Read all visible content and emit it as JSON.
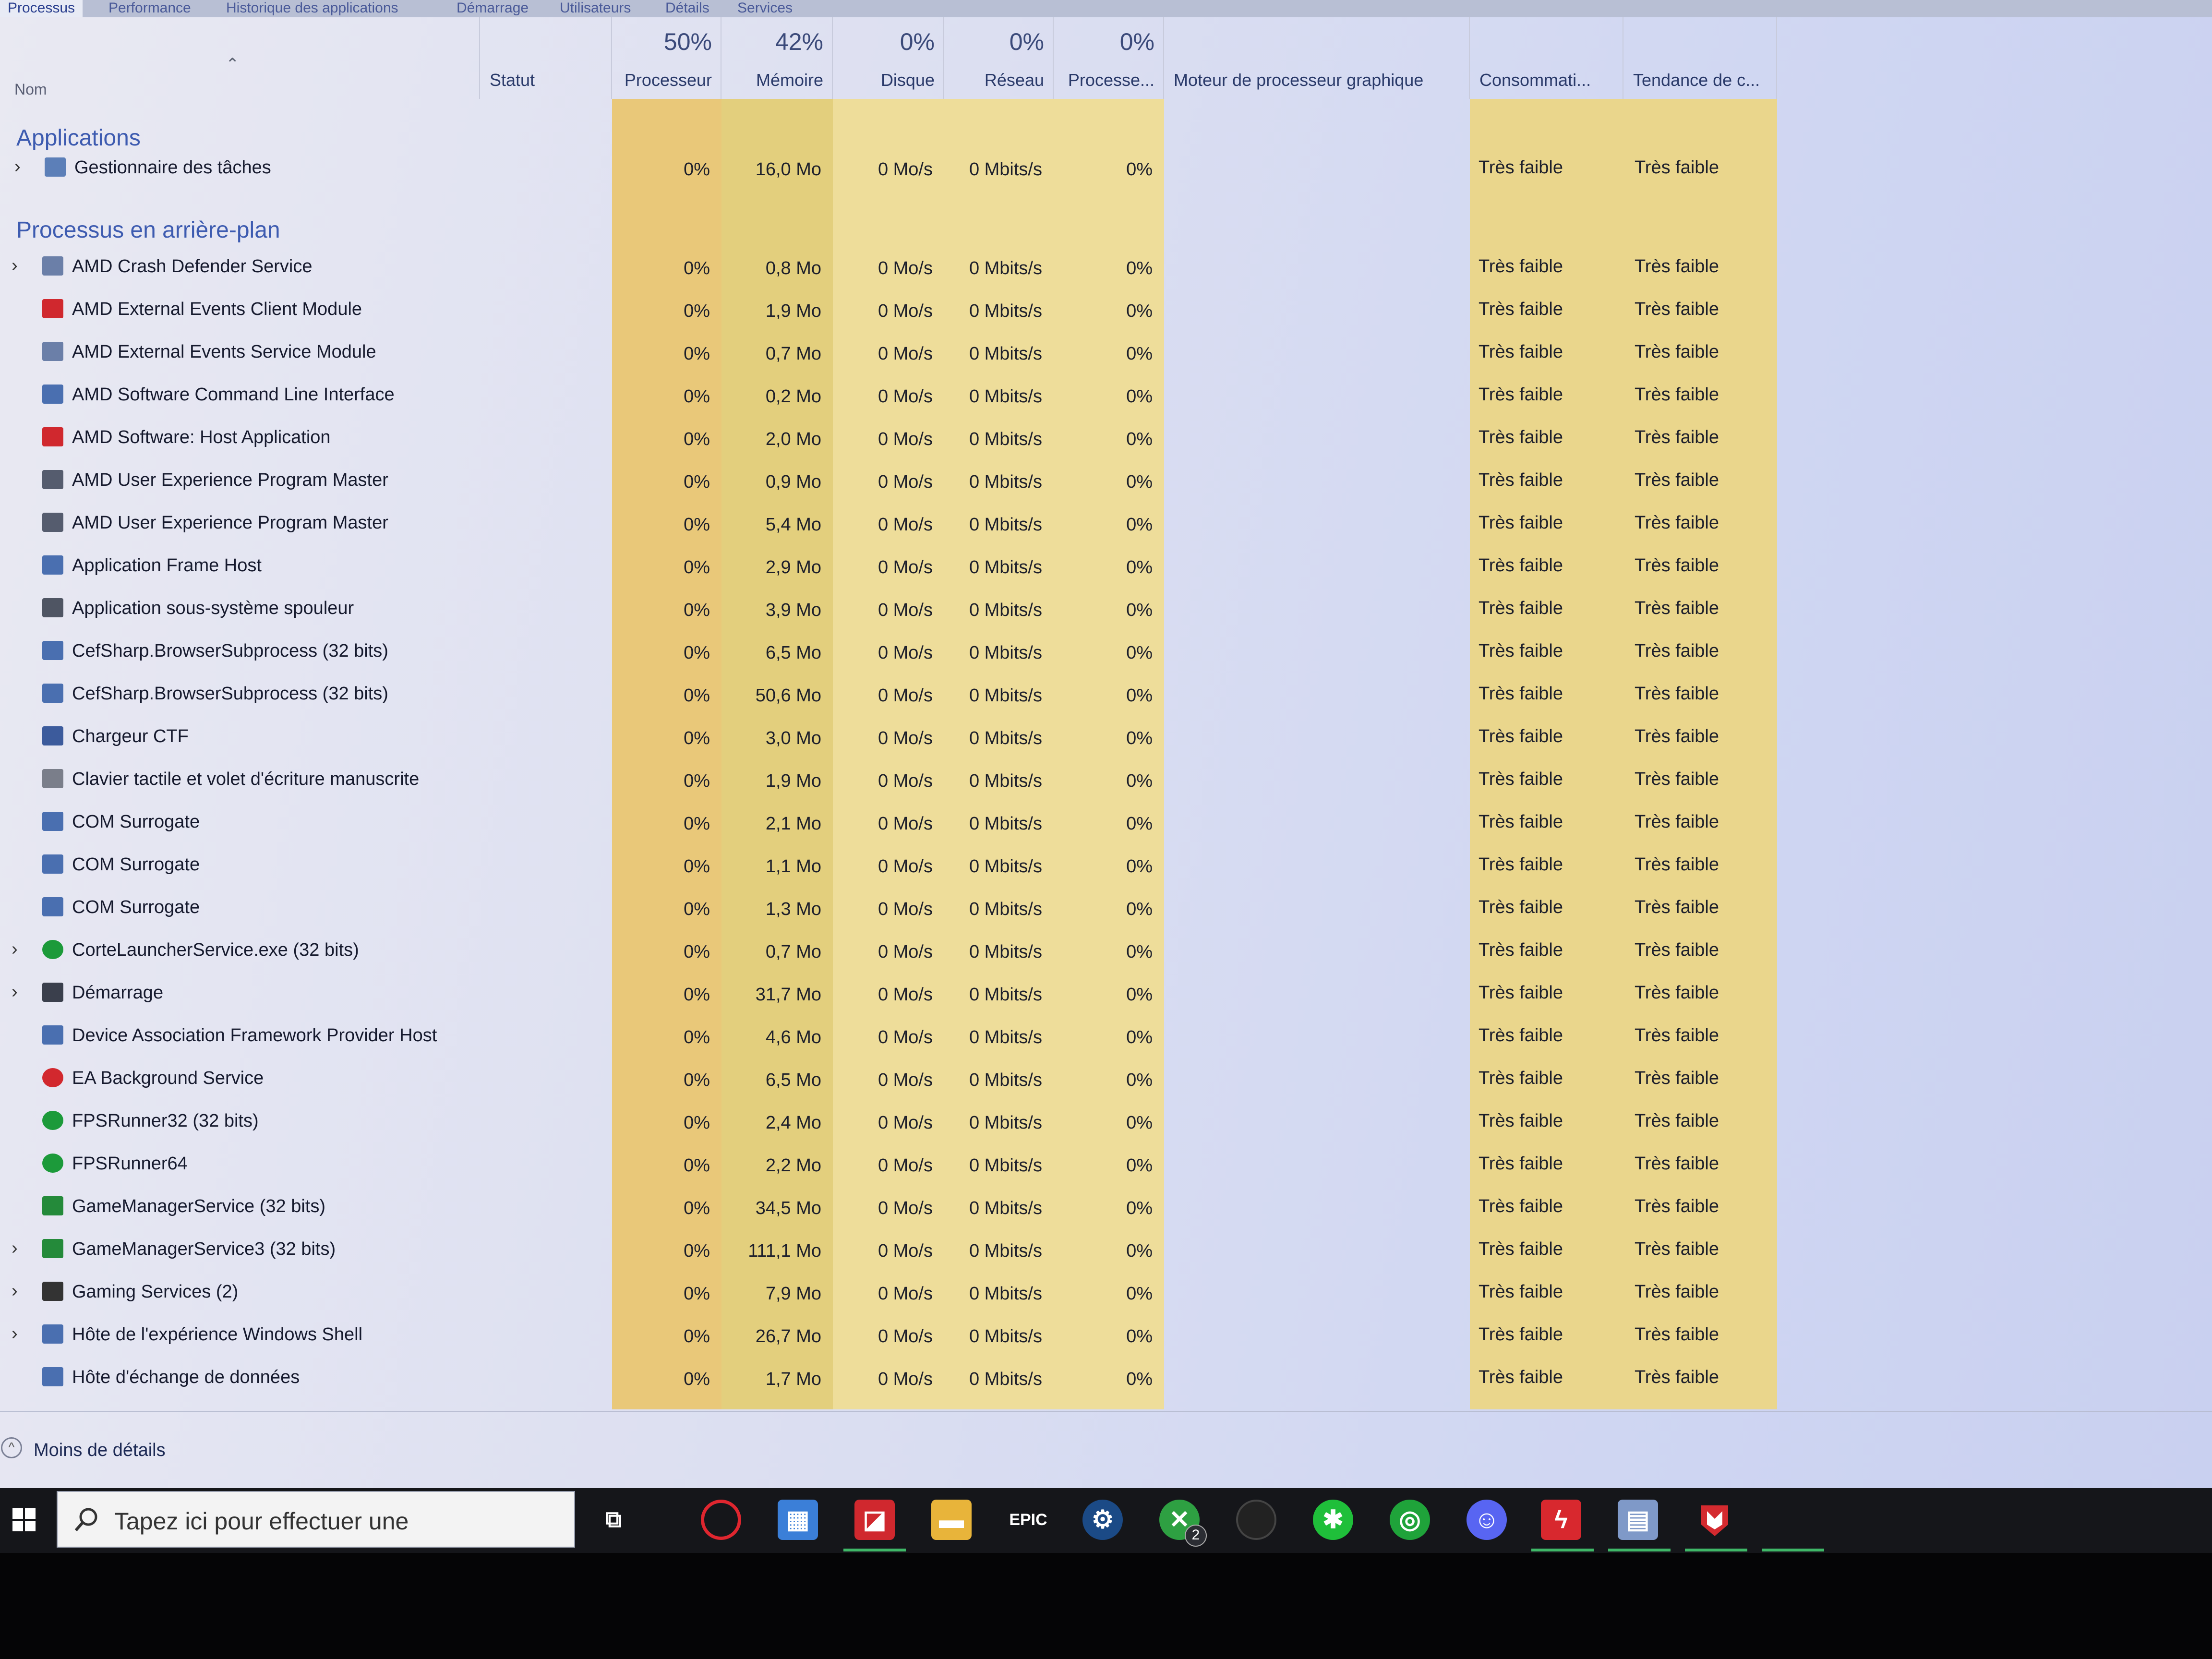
{
  "tabs": [
    "Processus",
    "Performance",
    "Historique des applications",
    "Démarrage",
    "Utilisateurs",
    "Détails",
    "Services"
  ],
  "columns": {
    "name": "Nom",
    "status": "Statut",
    "cpu": {
      "percent": "50%",
      "label": "Processeur"
    },
    "memory": {
      "percent": "42%",
      "label": "Mémoire"
    },
    "disk": {
      "percent": "0%",
      "label": "Disque"
    },
    "network": {
      "percent": "0%",
      "label": "Réseau"
    },
    "gpu": {
      "percent": "0%",
      "label": "Processe..."
    },
    "gpu_engine": "Moteur de processeur graphique",
    "power": "Consommati...",
    "power_trend": "Tendance de c..."
  },
  "groups": {
    "apps": "Applications",
    "background": "Processus en arrière-plan"
  },
  "apps": [
    {
      "name": "Gestionnaire des tâches",
      "cpu": "0%",
      "mem": "16,0 Mo",
      "disk": "0 Mo/s",
      "net": "0 Mbits/s",
      "gpu": "0%",
      "power": "Très faible",
      "trend": "Très faible",
      "icon": "task-manager-icon"
    }
  ],
  "processes": [
    {
      "name": "AMD Crash Defender Service",
      "mem": "0,8 Mo",
      "expand": true,
      "icon": "service-icon"
    },
    {
      "name": "AMD External Events Client Module",
      "mem": "1,9 Mo",
      "icon": "amd-icon"
    },
    {
      "name": "AMD External Events Service Module",
      "mem": "0,7 Mo",
      "icon": "service-icon"
    },
    {
      "name": "AMD Software Command Line Interface",
      "mem": "0,2 Mo",
      "icon": "window-icon"
    },
    {
      "name": "AMD Software: Host Application",
      "mem": "2,0 Mo",
      "icon": "amd-icon"
    },
    {
      "name": "AMD User Experience Program Master",
      "mem": "0,9 Mo",
      "icon": "gear-icon"
    },
    {
      "name": "AMD User Experience Program Master",
      "mem": "5,4 Mo",
      "icon": "gear-icon"
    },
    {
      "name": "Application Frame Host",
      "mem": "2,9 Mo",
      "icon": "window-icon"
    },
    {
      "name": "Application sous-système spouleur",
      "mem": "3,9 Mo",
      "icon": "printer-icon"
    },
    {
      "name": "CefSharp.BrowserSubprocess (32 bits)",
      "mem": "6,5 Mo",
      "icon": "window-icon"
    },
    {
      "name": "CefSharp.BrowserSubprocess (32 bits)",
      "mem": "50,6 Mo",
      "icon": "window-icon"
    },
    {
      "name": "Chargeur CTF",
      "mem": "3,0 Mo",
      "icon": "pen-icon"
    },
    {
      "name": "Clavier tactile et volet d'écriture manuscrite",
      "mem": "1,9 Mo",
      "icon": "keyboard-icon"
    },
    {
      "name": "COM Surrogate",
      "mem": "2,1 Mo",
      "icon": "window-icon"
    },
    {
      "name": "COM Surrogate",
      "mem": "1,1 Mo",
      "icon": "window-icon"
    },
    {
      "name": "COM Surrogate",
      "mem": "1,3 Mo",
      "icon": "window-icon"
    },
    {
      "name": "CorteLauncherService.exe (32 bits)",
      "mem": "0,7 Mo",
      "expand": true,
      "icon": "green-circle-icon"
    },
    {
      "name": "Démarrage",
      "mem": "31,7 Mo",
      "expand": true,
      "icon": "startup-icon"
    },
    {
      "name": "Device Association Framework Provider Host",
      "mem": "4,6 Mo",
      "icon": "window-icon"
    },
    {
      "name": "EA Background Service",
      "mem": "6,5 Mo",
      "icon": "ea-icon"
    },
    {
      "name": "FPSRunner32 (32 bits)",
      "mem": "2,4 Mo",
      "icon": "green-circle-icon"
    },
    {
      "name": "FPSRunner64",
      "mem": "2,2 Mo",
      "icon": "green-circle-icon"
    },
    {
      "name": "GameManagerService (32 bits)",
      "mem": "34,5 Mo",
      "icon": "green-gear-icon"
    },
    {
      "name": "GameManagerService3 (32 bits)",
      "mem": "111,1 Mo",
      "expand": true,
      "icon": "green-gear-icon"
    },
    {
      "name": "Gaming Services (2)",
      "mem": "7,9 Mo",
      "expand": true,
      "icon": "xbox-icon"
    },
    {
      "name": "Hôte de l'expérience Windows Shell",
      "mem": "26,7 Mo",
      "expand": true,
      "icon": "window-icon"
    },
    {
      "name": "Hôte d'échange de données",
      "mem": "1,7 Mo",
      "icon": "window-icon"
    }
  ],
  "row_defaults": {
    "cpu": "0%",
    "disk": "0 Mo/s",
    "net": "0 Mbits/s",
    "gpu": "0%",
    "power": "Très faible",
    "trend": "Très faible"
  },
  "footer": {
    "less_details": "Moins de détails"
  },
  "taskbar": {
    "search_placeholder": "Tapez ici pour effectuer une",
    "xbox_badge": "2",
    "epic_label": "EPIC",
    "icons": [
      "start-icon",
      "task-view-icon",
      "opera-icon",
      "store-icon",
      "amd-software-icon",
      "file-explorer-icon",
      "epic-games-icon",
      "steam-icon",
      "xbox-icon",
      "camera-icon",
      "razer-icon",
      "gaming-icon",
      "discord-icon",
      "ctf-icon",
      "task-manager-icon",
      "mcafee-icon"
    ]
  },
  "colors": {
    "cpu_col": "#e9c879",
    "mem_col": "#e3cf7d",
    "other_col": "#eedd9a",
    "power_col": "#ead68c",
    "group_text": "#3d5bb0"
  }
}
